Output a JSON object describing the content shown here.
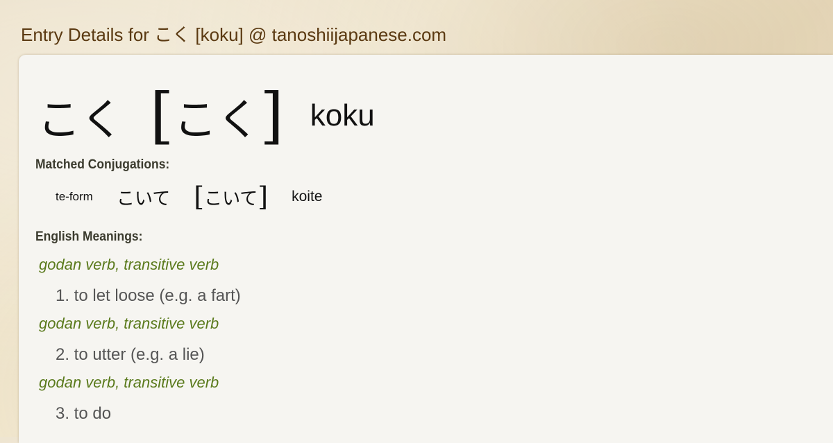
{
  "page": {
    "title": "Entry Details for こく [koku] @ tanoshiijapanese.com"
  },
  "entry": {
    "word": "こく",
    "bracket_open": "[",
    "reading": "こく",
    "bracket_close": "]",
    "romaji": "koku"
  },
  "conjugations": {
    "label": "Matched Conjugations:",
    "items": [
      {
        "type": "te-form",
        "word": "こいて",
        "bracket_open": "[",
        "reading": "こいて",
        "bracket_close": "]",
        "romaji": "koite"
      }
    ]
  },
  "meanings": {
    "label": "English Meanings:",
    "items": [
      {
        "pos": "godan verb, transitive verb",
        "gloss": "1. to let loose (e.g. a fart)"
      },
      {
        "pos": "godan verb, transitive verb",
        "gloss": "2. to utter (e.g. a lie)"
      },
      {
        "pos": "godan verb, transitive verb",
        "gloss": "3. to do"
      }
    ]
  },
  "colors": {
    "title": "#5b3a12",
    "part_of_speech": "#5a7a1c",
    "gloss": "#555555",
    "card_background": "#f6f5f1"
  }
}
